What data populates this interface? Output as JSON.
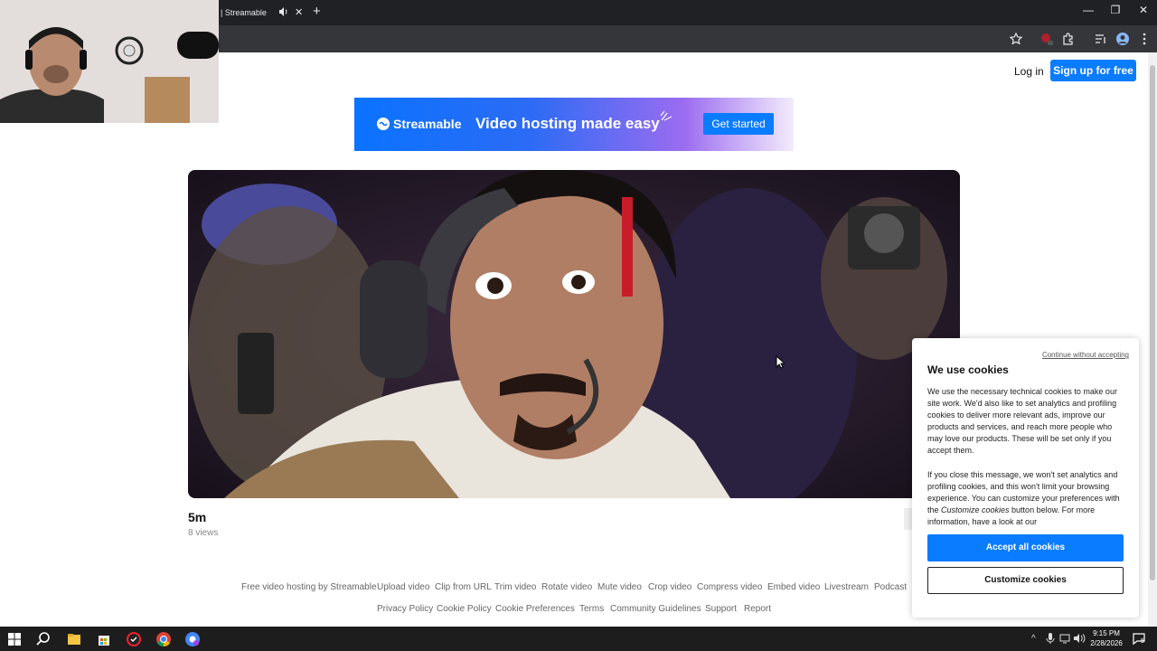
{
  "browser": {
    "tab_title": "| Streamable",
    "tab_close": "✕",
    "new_tab": "+",
    "window_controls": {
      "minimize": "—",
      "restore": "❐",
      "close": "✕"
    },
    "toolbar_icons": [
      "star-icon",
      "extension-red-icon",
      "puzzle-icon",
      "media-control-icon",
      "profile-icon",
      "kebab-menu-icon"
    ]
  },
  "header": {
    "login_label": "Log in",
    "signup_label": "Sign up for free"
  },
  "banner": {
    "brand": "Streamable",
    "tagline": "Video hosting made easy",
    "cta_label": "Get started"
  },
  "video": {
    "title": "5m",
    "views": "8 views"
  },
  "footer": {
    "row1": [
      "Free video hosting by Streamable",
      "Upload video",
      "Clip from URL",
      "Trim video",
      "Rotate video",
      "Mute video",
      "Crop video",
      "Compress video",
      "Embed video",
      "Livestream",
      "Podcast"
    ],
    "row2": [
      "Privacy Policy",
      "Cookie Policy",
      "Cookie Preferences",
      "Terms",
      "Community Guidelines",
      "Support",
      "Report"
    ]
  },
  "cookie_banner": {
    "continue_label": "Continue without accepting",
    "heading": "We use cookies",
    "para1": "We use the necessary technical cookies to make our site work. We'd also like to set analytics and profiling cookies to deliver more relevant ads, improve our products and services, and reach more people who may love our products. These will be set only if you accept them.",
    "para2_a": "If you close this message, we won't set analytics and profiling cookies, and this won't limit your browsing experience. You can customize your preferences with the ",
    "para2_em": "Customize cookies",
    "para2_b": " button below. For more information, have a look at our",
    "accept_label": "Accept all cookies",
    "customize_label": "Customize cookies"
  },
  "taskbar": {
    "time": "9:15 PM",
    "date": "2/28/2026",
    "notification_count": "5",
    "apps": [
      "windows-start-icon",
      "search-icon",
      "file-explorer-icon",
      "store-icon",
      "app-red-icon",
      "chrome-icon",
      "chrome-profile-icon"
    ]
  },
  "colors": {
    "accent": "#0a7cff",
    "chrome_dark": "#202124",
    "taskbar": "#1d1d1d"
  }
}
